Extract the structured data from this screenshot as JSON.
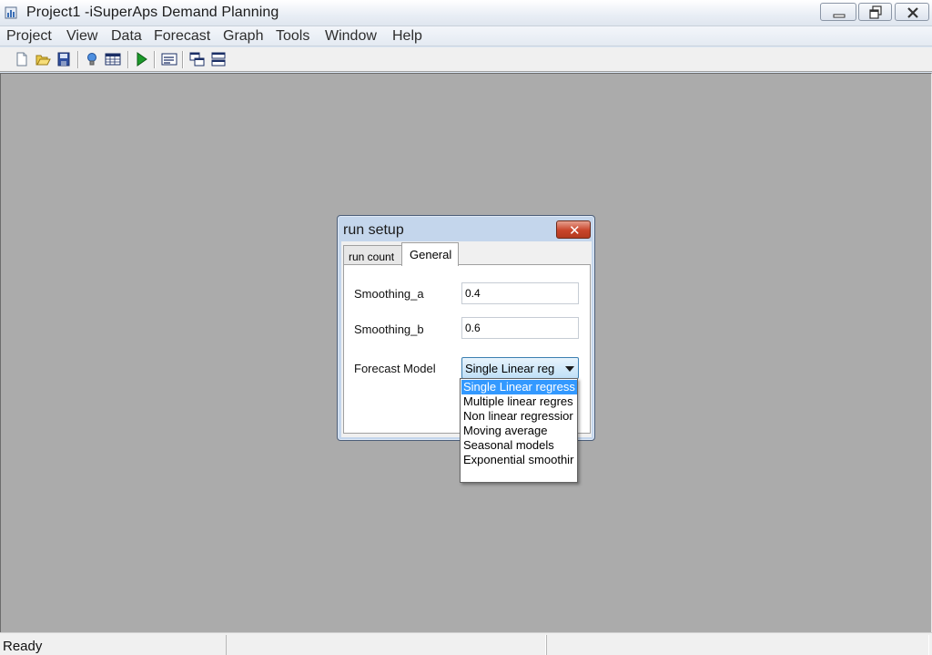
{
  "window": {
    "title": "Project1 -iSuperAps Demand Planning",
    "controls": [
      "minimize-icon",
      "restore-icon",
      "close-icon"
    ]
  },
  "menu": [
    {
      "label": "Project"
    },
    {
      "label": "View"
    },
    {
      "label": "Data"
    },
    {
      "label": "Forecast"
    },
    {
      "label": "Graph"
    },
    {
      "label": "Tools"
    },
    {
      "label": "Window"
    },
    {
      "label": "Help"
    }
  ],
  "toolbar": {
    "icons": [
      "new-file-icon",
      "open-folder-icon",
      "save-icon",
      "lightbulb-icon",
      "table-icon",
      "run-icon",
      "properties-icon",
      "cascade-windows-icon",
      "tile-windows-icon"
    ]
  },
  "dialog": {
    "title": "run setup",
    "tabs": [
      {
        "label": "run count"
      },
      {
        "label": "General"
      }
    ],
    "active_tab": "General",
    "fields": {
      "smoothing_a": {
        "label": "Smoothing_a",
        "value": "0.4"
      },
      "smoothing_b": {
        "label": "Smoothing_b",
        "value": "0.6"
      },
      "forecast_model": {
        "label": "Forecast Model",
        "value": "Single Linear reg"
      }
    },
    "dropdown_options": [
      "Single Linear regress",
      "Multiple linear regres",
      "Non linear regressior",
      "Moving average",
      "Seasonal models",
      "Exponential smoothir"
    ],
    "selected_index": 0
  },
  "status": {
    "text": "Ready"
  },
  "colors": {
    "workspace": "#ababab",
    "selection": "#3399ff",
    "close_button": "#c8442a"
  }
}
